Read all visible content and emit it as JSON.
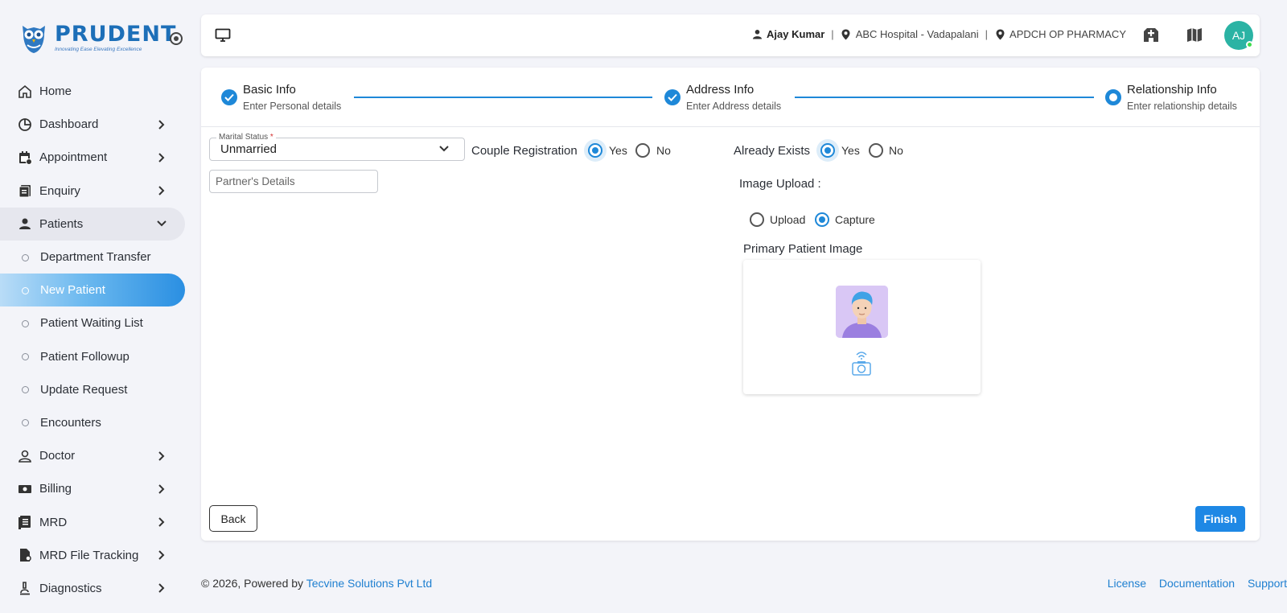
{
  "brand": {
    "name": "PRUDENT",
    "tagline": "Innovating Ease Elevating Excellence"
  },
  "sidebar": {
    "items": [
      {
        "label": "Home",
        "icon": "home-icon",
        "has_children": false
      },
      {
        "label": "Dashboard",
        "icon": "dashboard-icon",
        "has_children": true
      },
      {
        "label": "Appointment",
        "icon": "calendar-icon",
        "has_children": true
      },
      {
        "label": "Enquiry",
        "icon": "enquiry-icon",
        "has_children": true
      },
      {
        "label": "Patients",
        "icon": "person-icon",
        "has_children": true,
        "expanded": true
      },
      {
        "label": "Doctor",
        "icon": "doctor-icon",
        "has_children": true
      },
      {
        "label": "Billing",
        "icon": "billing-icon",
        "has_children": true
      },
      {
        "label": "MRD",
        "icon": "document-icon",
        "has_children": true
      },
      {
        "label": "MRD File Tracking",
        "icon": "file-tracking-icon",
        "has_children": true
      },
      {
        "label": "Diagnostics",
        "icon": "microscope-icon",
        "has_children": true
      }
    ],
    "patients_sub": [
      {
        "label": "Department Transfer",
        "active": false
      },
      {
        "label": "New Patient",
        "active": true
      },
      {
        "label": "Patient Waiting List",
        "active": false
      },
      {
        "label": "Patient Followup",
        "active": false
      },
      {
        "label": "Update Request",
        "active": false
      },
      {
        "label": "Encounters",
        "active": false
      }
    ]
  },
  "topbar": {
    "user": "Ajay Kumar",
    "hospital": "ABC Hospital - Vadapalani",
    "pharmacy": "APDCH OP PHARMACY",
    "avatar_initials": "AJ",
    "avatar_color": "#2bb3a4"
  },
  "stepper": {
    "steps": [
      {
        "title": "Basic Info",
        "subtitle": "Enter Personal details",
        "state": "done"
      },
      {
        "title": "Address Info",
        "subtitle": "Enter Address details",
        "state": "done"
      },
      {
        "title": "Relationship Info",
        "subtitle": "Enter relationship details",
        "state": "current"
      }
    ]
  },
  "form": {
    "marital_status": {
      "label": "Marital Status",
      "value": "Unmarried",
      "required": true
    },
    "couple_registration": {
      "label": "Couple Registration",
      "options": [
        "Yes",
        "No"
      ],
      "selected": "Yes"
    },
    "partner_details": {
      "placeholder": "Partner's Details",
      "value": ""
    },
    "already_exists": {
      "label": "Already Exists",
      "options": [
        "Yes",
        "No"
      ],
      "selected": "Yes"
    },
    "image_upload": {
      "label": "Image Upload :",
      "options": [
        "Upload",
        "Capture"
      ],
      "selected": "Capture"
    },
    "primary_image": {
      "label": "Primary Patient Image"
    }
  },
  "actions": {
    "back": "Back",
    "finish": "Finish"
  },
  "footer": {
    "copyright": "© 2026, Powered by",
    "company": "Tecvine Solutions Pvt Ltd",
    "links": [
      "License",
      "Documentation",
      "Support"
    ]
  },
  "colors": {
    "accent": "#1e88d8",
    "brand": "#1d6fb8"
  }
}
